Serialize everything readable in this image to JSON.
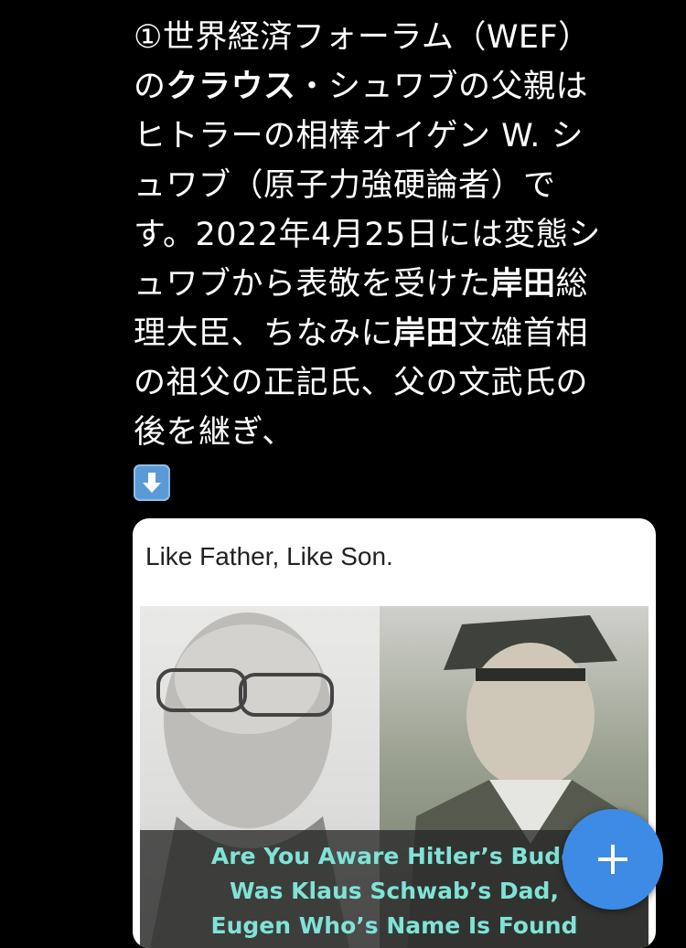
{
  "post": {
    "line1": "①世界経済フォーラム（WEF）",
    "line2_pre": "の",
    "line2_bold": "クラウス",
    "line2_post": "・シュワブの父親は",
    "line3": "ヒトラーの相棒オイゲン W. シ",
    "line4": "ュワブ（原子力強硬論者）で",
    "line5": "す。2022年4月25日には変態シ",
    "line6_pre": "ュワブから表敬を受けた",
    "line6_bold": "岸田",
    "line6_post": "総",
    "line7_pre": "理大臣、ちなみに",
    "line7_bold": "岸田",
    "line7_post": "文雄首相",
    "line8": "の祖父の正記氏、父の文武氏の",
    "line9": "後を継ぎ、",
    "arrow_icon": "down-arrow-icon"
  },
  "card": {
    "caption": "Like Father, Like Son.",
    "headline": "Are You Aware Hitler’s Budd\nWas Klaus Schwab’s Dad,\nEugen Who’s Name Is Found",
    "headline_color": "#7fe3d6"
  },
  "fab": {
    "icon": "plus-icon",
    "color": "#3d8be5"
  }
}
